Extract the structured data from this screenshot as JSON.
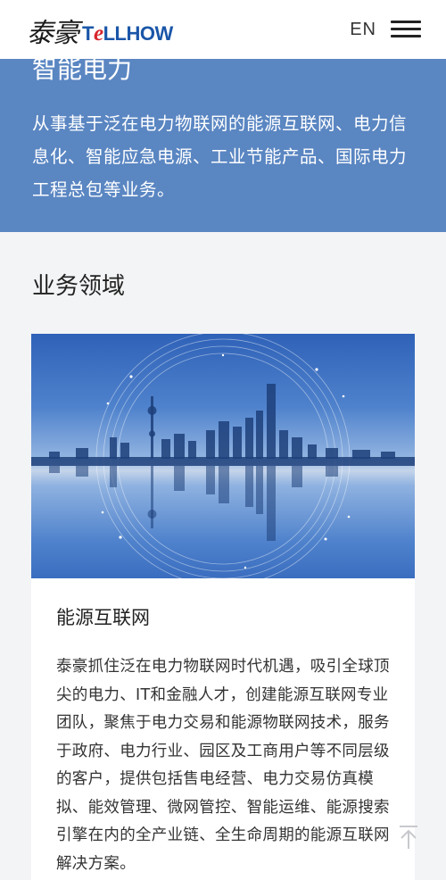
{
  "header": {
    "logo_cn": "泰豪",
    "logo_en_prefix": "T",
    "logo_en_e": "e",
    "logo_en_suffix": "LLHOW",
    "lang_label": "EN"
  },
  "hero": {
    "title": "智能电力",
    "description": "从事基于泛在电力物联网的能源互联网、电力信息化、智能应急电源、工业节能产品、国际电力工程总包等业务。"
  },
  "section": {
    "title": "业务领域"
  },
  "card": {
    "title": "能源互联网",
    "text": "泰豪抓住泛在电力物联网时代机遇，吸引全球顶尖的电力、IT和金融人才，创建能源互联网专业团队，聚焦于电力交易和能源物联网技术，服务于政府、电力行业、园区及工商用户等不同层级的客户，提供包括售电经营、电力交易仿真模拟、能效管理、微网管控、智能运维、能源搜索引擎在内的全产业链、全生命周期的能源互联网解决方案。"
  },
  "colors": {
    "hero_bg": "#5a86c2",
    "brand_blue": "#1a56a8",
    "brand_red": "#d7262d"
  },
  "icons": {
    "menu": "hamburger-icon",
    "back_to_top": "arrow-up-icon"
  }
}
